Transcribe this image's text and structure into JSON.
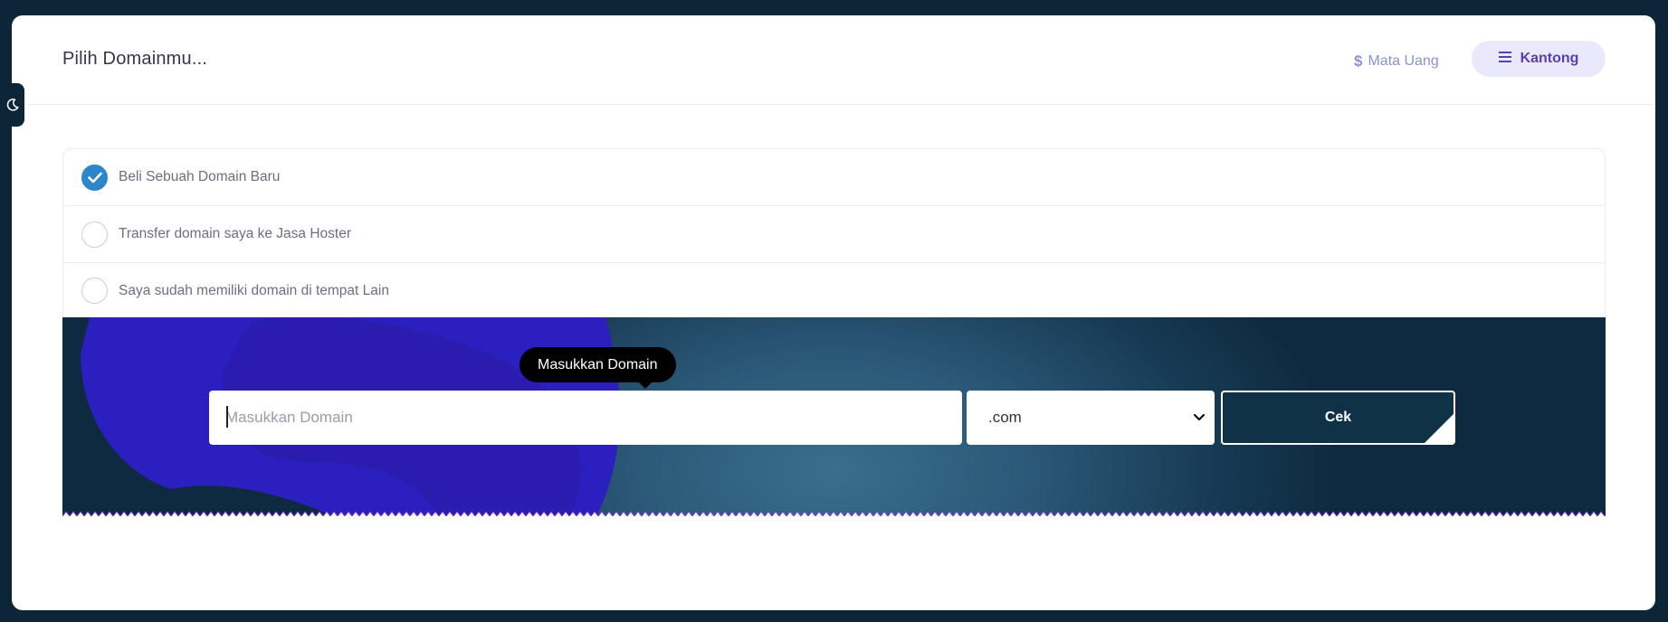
{
  "header": {
    "title": "Pilih Domainmu...",
    "currency_label": "Mata Uang",
    "cart_label": "Kantong"
  },
  "options": [
    {
      "label": "Beli Sebuah Domain Baru",
      "checked": true
    },
    {
      "label": "Transfer domain saya ke Jasa Hoster",
      "checked": false
    },
    {
      "label": "Saya sudah memiliki domain di tempat Lain",
      "checked": false
    }
  ],
  "search": {
    "tooltip": "Masukkan Domain",
    "placeholder": "Masukkan Domain",
    "value": "",
    "tld_selected": ".com",
    "check_label": "Cek"
  },
  "colors": {
    "page_background": "#0c2638",
    "accent_blue": "#2c86c9",
    "cart_background": "#eae8fb",
    "cart_text": "#5a3fb0",
    "currency_text": "#8a93cf",
    "blob": "#2f24c4"
  },
  "icons": {
    "theme_toggle": "moon-icon",
    "currency": "dollar-icon",
    "cart": "menu-icon",
    "checked_option": "check-icon",
    "select": "chevron-down-icon"
  }
}
